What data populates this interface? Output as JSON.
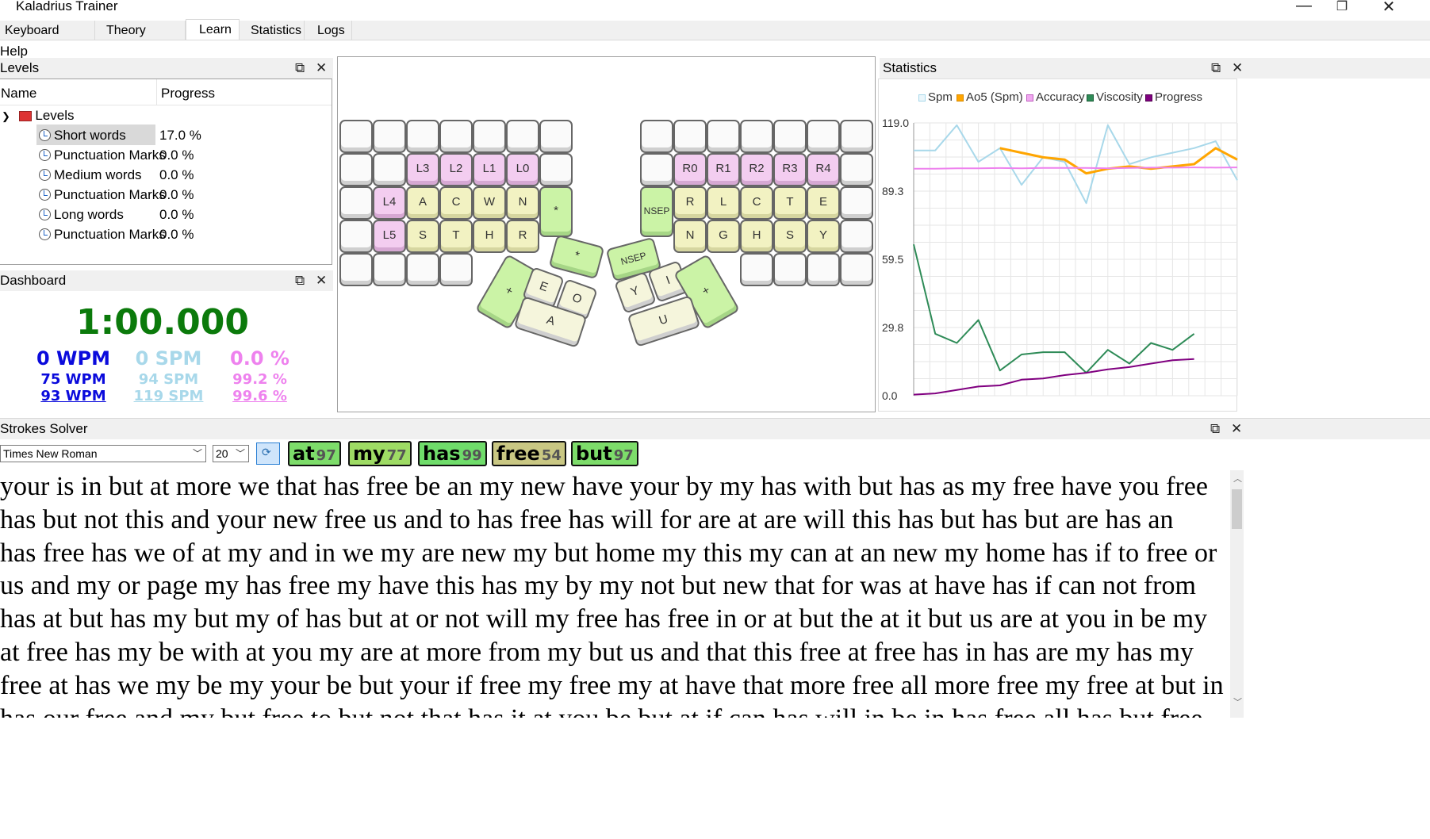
{
  "window": {
    "title": "Kaladrius Trainer"
  },
  "tabs": [
    "Keyboard Editor",
    "Theory Editor",
    "Learn",
    "Statistics",
    "Logs"
  ],
  "active_tab": "Learn",
  "menu": {
    "help": "Help"
  },
  "levels_panel": {
    "title": "Levels",
    "col_name": "Name",
    "col_progress": "Progress",
    "root": "Levels",
    "items": [
      {
        "name": "Short words",
        "progress": "17.0 %"
      },
      {
        "name": "Punctuation Marks",
        "progress": "0.0 %"
      },
      {
        "name": "Medium words",
        "progress": "0.0 %"
      },
      {
        "name": "Punctuation Marks",
        "progress": "0.0 %"
      },
      {
        "name": "Long words",
        "progress": "0.0 %"
      },
      {
        "name": "Punctuation Marks",
        "progress": "0.0 %"
      }
    ]
  },
  "dashboard": {
    "title": "Dashboard",
    "timer": "1:00.000",
    "wpm": [
      "0 WPM",
      "75 WPM",
      "93 WPM"
    ],
    "spm": [
      "0 SPM",
      "94 SPM",
      "119 SPM"
    ],
    "accuracy": [
      "0.0 %",
      "99.2 %",
      "99.6 %"
    ]
  },
  "keyboard": {
    "rows": {
      "r1_left": [
        "L3",
        "L2",
        "L1",
        "L0"
      ],
      "r1_right": [
        "R0",
        "R1",
        "R2",
        "R3",
        "R4"
      ],
      "r2_left": [
        "L4",
        "A",
        "C",
        "W",
        "N",
        "*"
      ],
      "r2_right": [
        "NSEP",
        "R",
        "L",
        "C",
        "T",
        "E"
      ],
      "r3_left": [
        "L5",
        "S",
        "T",
        "H",
        "R"
      ],
      "r3_right": [
        "N",
        "G",
        "H",
        "S",
        "Y"
      ],
      "thumb_left": [
        "*",
        "+",
        "E",
        "O",
        "A"
      ],
      "thumb_right": [
        "NSEP",
        "Y",
        "I",
        "+",
        "U"
      ]
    }
  },
  "statistics_panel": {
    "title": "Statistics",
    "legend": [
      {
        "name": "Spm",
        "color": "#a8d8ea"
      },
      {
        "name": "Ao5 (Spm)",
        "color": "#ffa500"
      },
      {
        "name": "Accuracy",
        "color": "#ee82ee"
      },
      {
        "name": "Viscosity",
        "color": "#2e8b57"
      },
      {
        "name": "Progress",
        "color": "#800080"
      }
    ]
  },
  "chart_data": {
    "type": "line",
    "yticks": [
      "119.0",
      "89.3",
      "59.5",
      "29.8",
      "0.0"
    ],
    "ylim": [
      0,
      119
    ],
    "grid": true,
    "legend_position": "top",
    "x": [
      0,
      1,
      2,
      3,
      4,
      5,
      6,
      7,
      8,
      9,
      10,
      11,
      12,
      13,
      14,
      15
    ],
    "series": [
      {
        "name": "Spm",
        "color": "#a8d8ea",
        "values": [
          107,
          107,
          118,
          102,
          108,
          92,
          104,
          102,
          84,
          118,
          101,
          104,
          106,
          108,
          111,
          94
        ]
      },
      {
        "name": "Ao5 (Spm)",
        "color": "#ffa500",
        "values": [
          null,
          null,
          null,
          null,
          108,
          106,
          104,
          103,
          97,
          99,
          100,
          99,
          100,
          101,
          108,
          103
        ]
      },
      {
        "name": "Accuracy",
        "color": "#ee82ee",
        "values": [
          99.0,
          99.0,
          99.2,
          99.2,
          99.3,
          99.2,
          99.4,
          99.4,
          99.4,
          99.2,
          99.4,
          99.5,
          99.5,
          99.6,
          99.5,
          99.6
        ]
      },
      {
        "name": "Viscosity",
        "color": "#2e8b57",
        "values": [
          66,
          27,
          23,
          33,
          11,
          18,
          19,
          19,
          10,
          20,
          14,
          23,
          20,
          27
        ]
      },
      {
        "name": "Progress",
        "color": "#800080",
        "values": [
          0.5,
          1,
          2.5,
          4,
          4.5,
          7,
          7.5,
          9,
          10,
          11.5,
          12.5,
          14,
          15.5,
          16
        ]
      }
    ]
  },
  "strokes_solver": {
    "title": "Strokes Solver",
    "font_select": "Times New Roman",
    "size_select": "20",
    "chips": [
      {
        "word": "at",
        "n": "97",
        "color": "#7ddc6a"
      },
      {
        "word": "my",
        "n": "77",
        "color": "#9edb64"
      },
      {
        "word": "has",
        "n": "99",
        "color": "#6fdc6a"
      },
      {
        "word": "free",
        "n": "54",
        "color": "#c9c783"
      },
      {
        "word": "but",
        "n": "97",
        "color": "#7ddc6a"
      }
    ]
  },
  "practice_text": [
    "your is in but at more we that has free be an my new have your by my has with but has as my free have you free",
    "has but not this and your new free us and to has free has will for are at are will this has but has but are has an",
    "has free has we of at my and in we my are new my but home my this my can at an new my home has if to free or",
    "us and my or page my has free my have this has my by my not but new that for was at have has if can not from",
    "has at but has my but my of has but at or not will my free has free in or at but the at it but us are at you in be my",
    "at free has my be with at you my are at more from my but us and that this free at free has in has are my has my",
    "free at has we my be my your be but your if free my free my at have that more free all more free my free at but in",
    "has our free and my but free to but not that has it at you be but at if can has will in be in has free all has but free"
  ]
}
